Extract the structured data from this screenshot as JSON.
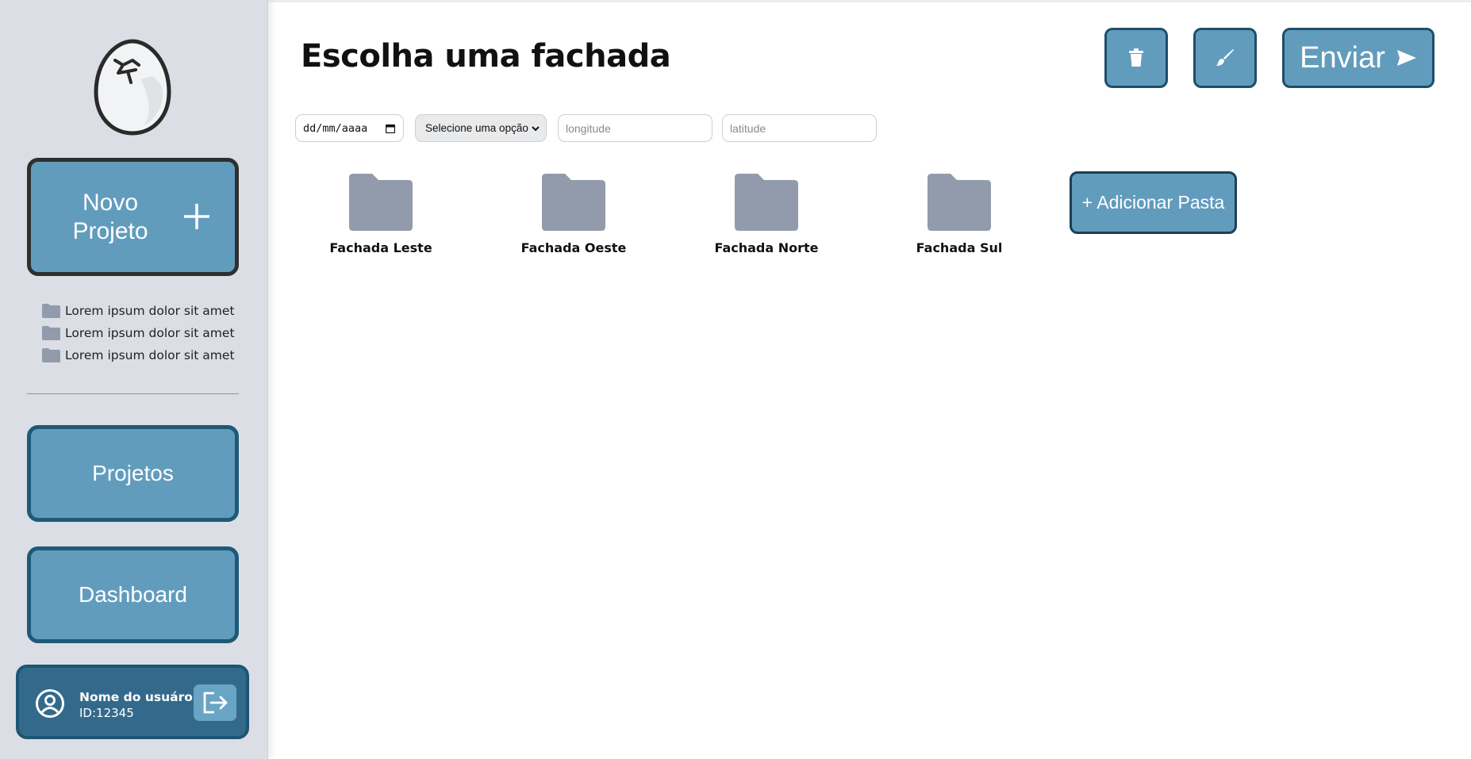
{
  "colors": {
    "sidebar_bg": "#dcdee5",
    "button_blue": "#629cbd",
    "user_card_bg": "#336a8c",
    "folder_gray": "#929bab"
  },
  "sidebar": {
    "logo_icon": "cracked-egg-icon",
    "new_project": {
      "label": "Novo Projeto",
      "icon": "plus-icon"
    },
    "recent_projects": [
      {
        "label": "Lorem ipsum dolor sit amet",
        "icon": "folder-icon"
      },
      {
        "label": "Lorem ipsum dolor sit amet",
        "icon": "folder-icon"
      },
      {
        "label": "Lorem ipsum dolor sit amet",
        "icon": "folder-icon"
      }
    ],
    "nav": [
      {
        "label": "Projetos"
      },
      {
        "label": "Dashboard"
      }
    ],
    "user": {
      "name": "Nome do usuáro",
      "id": "ID:12345",
      "avatar_icon": "user-circle-icon",
      "logout_icon": "logout-icon"
    }
  },
  "header": {
    "title": "Escolha uma fachada",
    "trash_icon": "trash-icon",
    "brush_icon": "brush-icon",
    "send_label": "Enviar",
    "send_icon": "send-arrow-icon"
  },
  "filters": {
    "date_placeholder": "dd/mm/aaaa",
    "select_value": "Selecione uma opção",
    "longitude_placeholder": "longitude",
    "latitude_placeholder": "latitude"
  },
  "folders": [
    {
      "label": "Fachada Leste"
    },
    {
      "label": "Fachada Oeste"
    },
    {
      "label": "Fachada Norte"
    },
    {
      "label": "Fachada Sul"
    }
  ],
  "add_folder_label": "+ Adicionar Pasta"
}
